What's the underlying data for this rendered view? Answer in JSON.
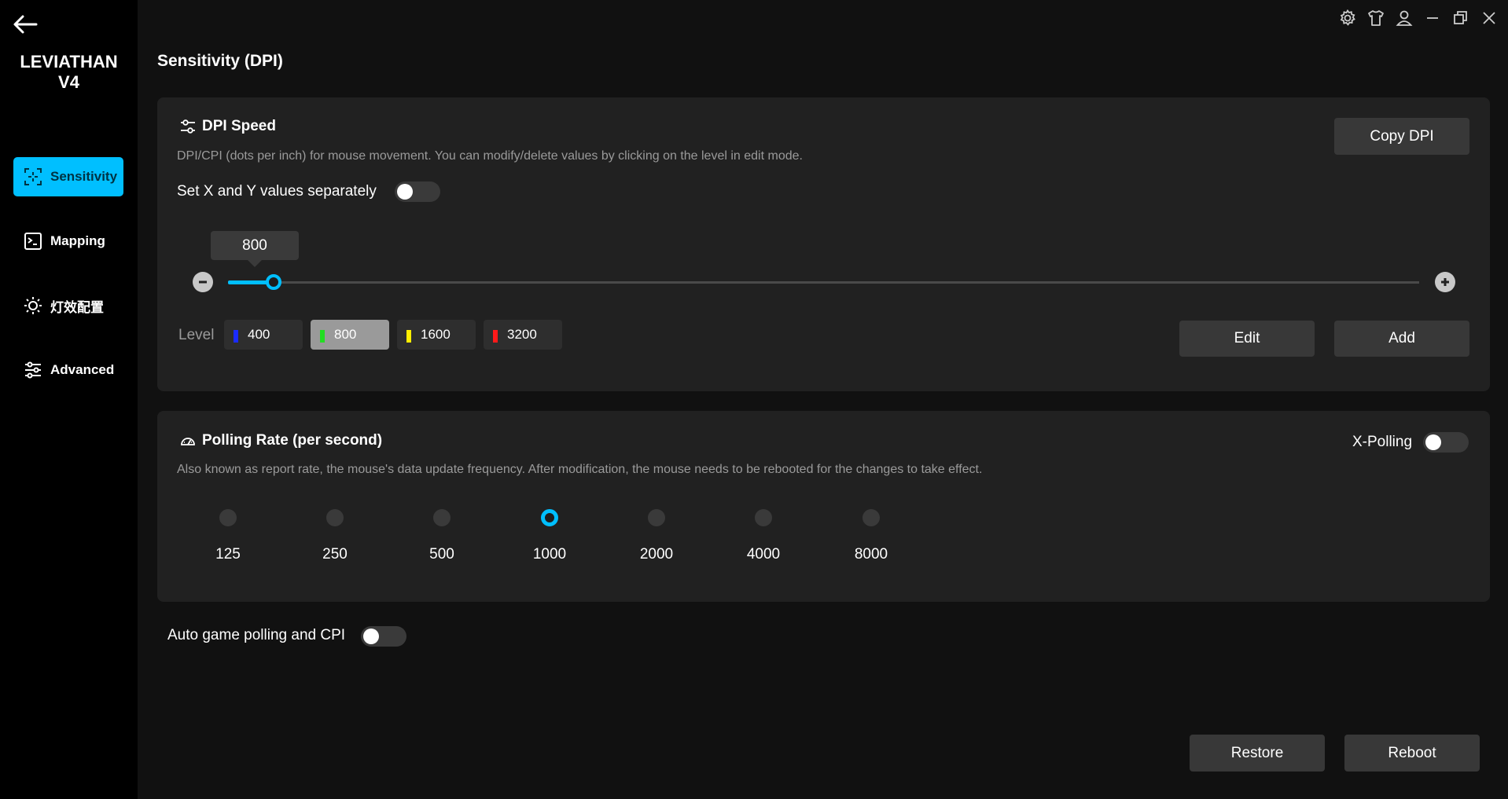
{
  "app": {
    "device_name": "LEVIATHAN\nV4"
  },
  "sidebar": {
    "items": [
      {
        "label": "Sensitivity",
        "icon": "sensitivity-icon",
        "active": true
      },
      {
        "label": "Mapping",
        "icon": "mapping-icon",
        "active": false
      },
      {
        "label": "灯效配置",
        "icon": "lighting-icon",
        "active": false
      },
      {
        "label": "Advanced",
        "icon": "advanced-icon",
        "active": false
      }
    ]
  },
  "header": {
    "title": "Sensitivity (DPI)"
  },
  "dpi": {
    "title": "DPI Speed",
    "description": "DPI/CPI (dots per inch) for mouse movement. You can modify/delete values by clicking on the level in edit mode.",
    "xy_label": "Set X and Y values separately",
    "current_value": "800",
    "copy_label": "Copy DPI",
    "level_label": "Level",
    "levels": [
      {
        "value": "400",
        "color": "#1a2bff"
      },
      {
        "value": "800",
        "color": "#22dd22"
      },
      {
        "value": "1600",
        "color": "#ffee00"
      },
      {
        "value": "3200",
        "color": "#ff1a1a"
      }
    ],
    "selected_level": 1,
    "edit_label": "Edit",
    "add_label": "Add"
  },
  "polling": {
    "title": "Polling Rate (per second)",
    "description": "Also known as report rate, the mouse's data update frequency. After modification, the mouse needs to be rebooted for the changes to take effect.",
    "xpolling_label": "X-Polling",
    "rates": [
      "125",
      "250",
      "500",
      "1000",
      "2000",
      "4000",
      "8000"
    ],
    "selected_rate": "1000"
  },
  "auto": {
    "label": "Auto game polling and CPI"
  },
  "footer": {
    "restore_label": "Restore",
    "reboot_label": "Reboot"
  },
  "colors": {
    "accent": "#00bfff",
    "card": "#212121",
    "background": "#111111",
    "sidebar": "#000000"
  }
}
